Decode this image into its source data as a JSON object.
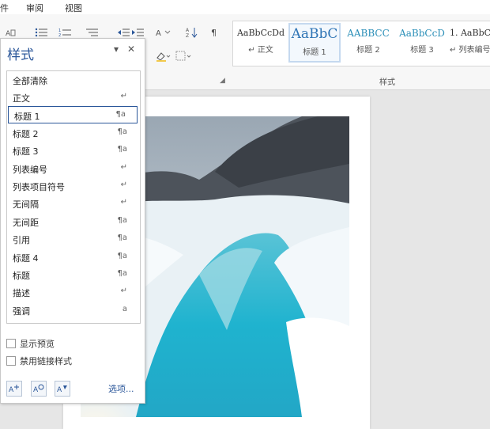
{
  "menubar": {
    "items": [
      {
        "label": "件"
      },
      {
        "label": "审阅"
      },
      {
        "label": "视图"
      }
    ]
  },
  "ribbon": {
    "styles_group_label": "样式",
    "gallery": [
      {
        "sample": "AaBbCcDd",
        "name": "↵ 正文",
        "selected": false
      },
      {
        "sample": "AaBbC",
        "name": "标题 1",
        "selected": true
      },
      {
        "sample": "AABBCC",
        "name": "标题 2",
        "selected": false
      },
      {
        "sample": "AaBbCcD",
        "name": "标题 3",
        "selected": false
      },
      {
        "sample": "1. AaBbC",
        "name": "↵ 列表编号",
        "selected": false
      }
    ],
    "colors": {
      "heading": "#2b8fb8",
      "heading1": "#2e74b5"
    }
  },
  "pane": {
    "title": "样式",
    "items": [
      {
        "label": "全部清除",
        "mark": ""
      },
      {
        "label": "正文",
        "mark": "↵"
      },
      {
        "label": "标题 1",
        "mark": "¶a",
        "selected": true
      },
      {
        "label": "标题 2",
        "mark": "¶a"
      },
      {
        "label": "标题 3",
        "mark": "¶a"
      },
      {
        "label": "列表编号",
        "mark": "↵"
      },
      {
        "label": "列表项目符号",
        "mark": "↵"
      },
      {
        "label": "无间隔",
        "mark": "↵"
      },
      {
        "label": "无间距",
        "mark": "¶a"
      },
      {
        "label": "引用",
        "mark": "¶a"
      },
      {
        "label": "标题 4",
        "mark": "¶a"
      },
      {
        "label": "标题",
        "mark": "¶a"
      },
      {
        "label": "描述",
        "mark": "↵"
      },
      {
        "label": "强调",
        "mark": "a"
      }
    ],
    "show_preview_label": "显示预览",
    "disable_linked_label": "禁用链接样式",
    "options_label": "选项..."
  }
}
